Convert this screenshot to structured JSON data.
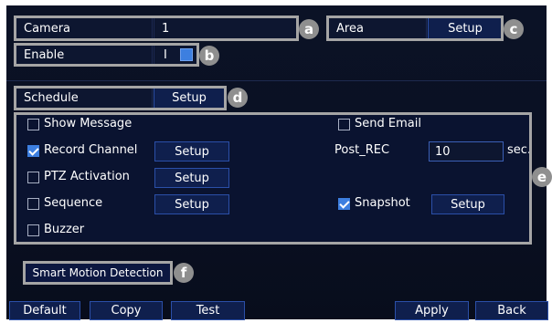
{
  "camera": {
    "label": "Camera",
    "value": "1"
  },
  "area": {
    "label": "Area",
    "setup_label": "Setup"
  },
  "enable": {
    "label": "Enable",
    "value": "I"
  },
  "schedule": {
    "label": "Schedule",
    "setup_label": "Setup"
  },
  "actions": {
    "show_message": {
      "label": "Show Message",
      "checked": false
    },
    "send_email": {
      "label": "Send Email",
      "checked": false
    },
    "record_channel": {
      "label": "Record Channel",
      "checked": true,
      "setup_label": "Setup"
    },
    "post_rec": {
      "label": "Post_REC",
      "value": "10",
      "unit": "sec."
    },
    "ptz_activation": {
      "label": "PTZ Activation",
      "checked": false,
      "setup_label": "Setup"
    },
    "sequence": {
      "label": "Sequence",
      "checked": false,
      "setup_label": "Setup"
    },
    "snapshot": {
      "label": "Snapshot",
      "checked": true,
      "setup_label": "Setup"
    },
    "buzzer": {
      "label": "Buzzer",
      "checked": false
    }
  },
  "smart_motion": {
    "label": "Smart Motion Detection"
  },
  "footer": {
    "default_label": "Default",
    "copy_label": "Copy",
    "test_label": "Test",
    "apply_label": "Apply",
    "back_label": "Back"
  },
  "callouts": {
    "a": "a",
    "b": "b",
    "c": "c",
    "d": "d",
    "e": "e",
    "f": "f"
  },
  "colors": {
    "background": "#0a1022",
    "button": "#0f1f4d",
    "accent": "#3d7fe0",
    "callout": "#8f8f8f"
  }
}
